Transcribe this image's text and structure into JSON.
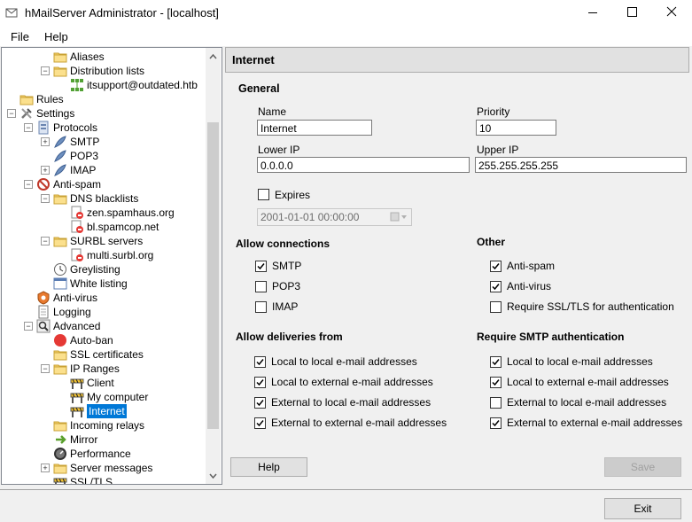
{
  "window": {
    "title": "hMailServer Administrator - [localhost]"
  },
  "menu": {
    "file": "File",
    "help": "Help"
  },
  "tree": [
    {
      "label": "Aliases",
      "indent": 3,
      "icon": "folder",
      "expander": "none"
    },
    {
      "label": "Distribution lists",
      "indent": 3,
      "icon": "folder",
      "expander": "minus"
    },
    {
      "label": "itsupport@outdated.htb",
      "indent": 4,
      "icon": "dist-list",
      "expander": "none"
    },
    {
      "label": "Rules",
      "indent": 1,
      "icon": "folder",
      "expander": "none"
    },
    {
      "label": "Settings",
      "indent": 1,
      "icon": "tools",
      "expander": "minus"
    },
    {
      "label": "Protocols",
      "indent": 2,
      "icon": "protocols",
      "expander": "minus"
    },
    {
      "label": "SMTP",
      "indent": 3,
      "icon": "feather",
      "expander": "plus"
    },
    {
      "label": "POP3",
      "indent": 3,
      "icon": "feather",
      "expander": "none"
    },
    {
      "label": "IMAP",
      "indent": 3,
      "icon": "feather",
      "expander": "plus"
    },
    {
      "label": "Anti-spam",
      "indent": 2,
      "icon": "antispam",
      "expander": "minus"
    },
    {
      "label": "DNS blacklists",
      "indent": 3,
      "icon": "folder",
      "expander": "minus"
    },
    {
      "label": "zen.spamhaus.org",
      "indent": 4,
      "icon": "blacklist",
      "expander": "none"
    },
    {
      "label": "bl.spamcop.net",
      "indent": 4,
      "icon": "blacklist",
      "expander": "none"
    },
    {
      "label": "SURBL servers",
      "indent": 3,
      "icon": "folder",
      "expander": "minus"
    },
    {
      "label": "multi.surbl.org",
      "indent": 4,
      "icon": "blacklist",
      "expander": "none"
    },
    {
      "label": "Greylisting",
      "indent": 3,
      "icon": "clock",
      "expander": "none"
    },
    {
      "label": "White listing",
      "indent": 3,
      "icon": "window",
      "expander": "none"
    },
    {
      "label": "Anti-virus",
      "indent": 2,
      "icon": "antivirus",
      "expander": "none"
    },
    {
      "label": "Logging",
      "indent": 2,
      "icon": "document",
      "expander": "none"
    },
    {
      "label": "Advanced",
      "indent": 2,
      "icon": "magnifier",
      "expander": "minus"
    },
    {
      "label": "Auto-ban",
      "indent": 3,
      "icon": "red-circle",
      "expander": "none"
    },
    {
      "label": "SSL certificates",
      "indent": 3,
      "icon": "folder",
      "expander": "none"
    },
    {
      "label": "IP Ranges",
      "indent": 3,
      "icon": "folder",
      "expander": "minus"
    },
    {
      "label": "Client",
      "indent": 4,
      "icon": "barrier",
      "expander": "none"
    },
    {
      "label": "My computer",
      "indent": 4,
      "icon": "barrier",
      "expander": "none"
    },
    {
      "label": "Internet",
      "indent": 4,
      "icon": "barrier",
      "expander": "none",
      "selected": true
    },
    {
      "label": "Incoming relays",
      "indent": 3,
      "icon": "folder",
      "expander": "none"
    },
    {
      "label": "Mirror",
      "indent": 3,
      "icon": "mirror",
      "expander": "none"
    },
    {
      "label": "Performance",
      "indent": 3,
      "icon": "gauge",
      "expander": "none"
    },
    {
      "label": "Server messages",
      "indent": 3,
      "icon": "folder",
      "expander": "plus"
    },
    {
      "label": "SSL/TLS",
      "indent": 3,
      "icon": "barrier",
      "expander": "none"
    }
  ],
  "panel": {
    "header": "Internet",
    "general_label": "General",
    "name_label": "Name",
    "name_value": "Internet",
    "priority_label": "Priority",
    "priority_value": "10",
    "lower_ip_label": "Lower IP",
    "lower_ip_value": "0.0.0.0",
    "upper_ip_label": "Upper IP",
    "upper_ip_value": "255.255.255.255",
    "expires_label": "Expires",
    "expires_checked": false,
    "expires_value": "2001-01-01 00:00:00",
    "allow_connections_label": "Allow connections",
    "allow_connections": [
      {
        "label": "SMTP",
        "checked": true
      },
      {
        "label": "POP3",
        "checked": false
      },
      {
        "label": "IMAP",
        "checked": false
      }
    ],
    "other_label": "Other",
    "other": [
      {
        "label": "Anti-spam",
        "checked": true
      },
      {
        "label": "Anti-virus",
        "checked": true
      },
      {
        "label": "Require SSL/TLS for authentication",
        "checked": false
      }
    ],
    "allow_deliveries_label": "Allow deliveries from",
    "allow_deliveries": [
      {
        "label": "Local to local e-mail addresses",
        "checked": true
      },
      {
        "label": "Local to external e-mail addresses",
        "checked": true
      },
      {
        "label": "External to local e-mail addresses",
        "checked": true
      },
      {
        "label": "External to external e-mail addresses",
        "checked": true
      }
    ],
    "require_smtp_label": "Require SMTP authentication",
    "require_smtp": [
      {
        "label": "Local to local e-mail addresses",
        "checked": true
      },
      {
        "label": "Local to external e-mail addresses",
        "checked": true
      },
      {
        "label": "External to local e-mail addresses",
        "checked": false
      },
      {
        "label": "External to external e-mail addresses",
        "checked": true
      }
    ],
    "help_button": "Help",
    "save_button": "Save"
  },
  "footer": {
    "exit_button": "Exit"
  }
}
